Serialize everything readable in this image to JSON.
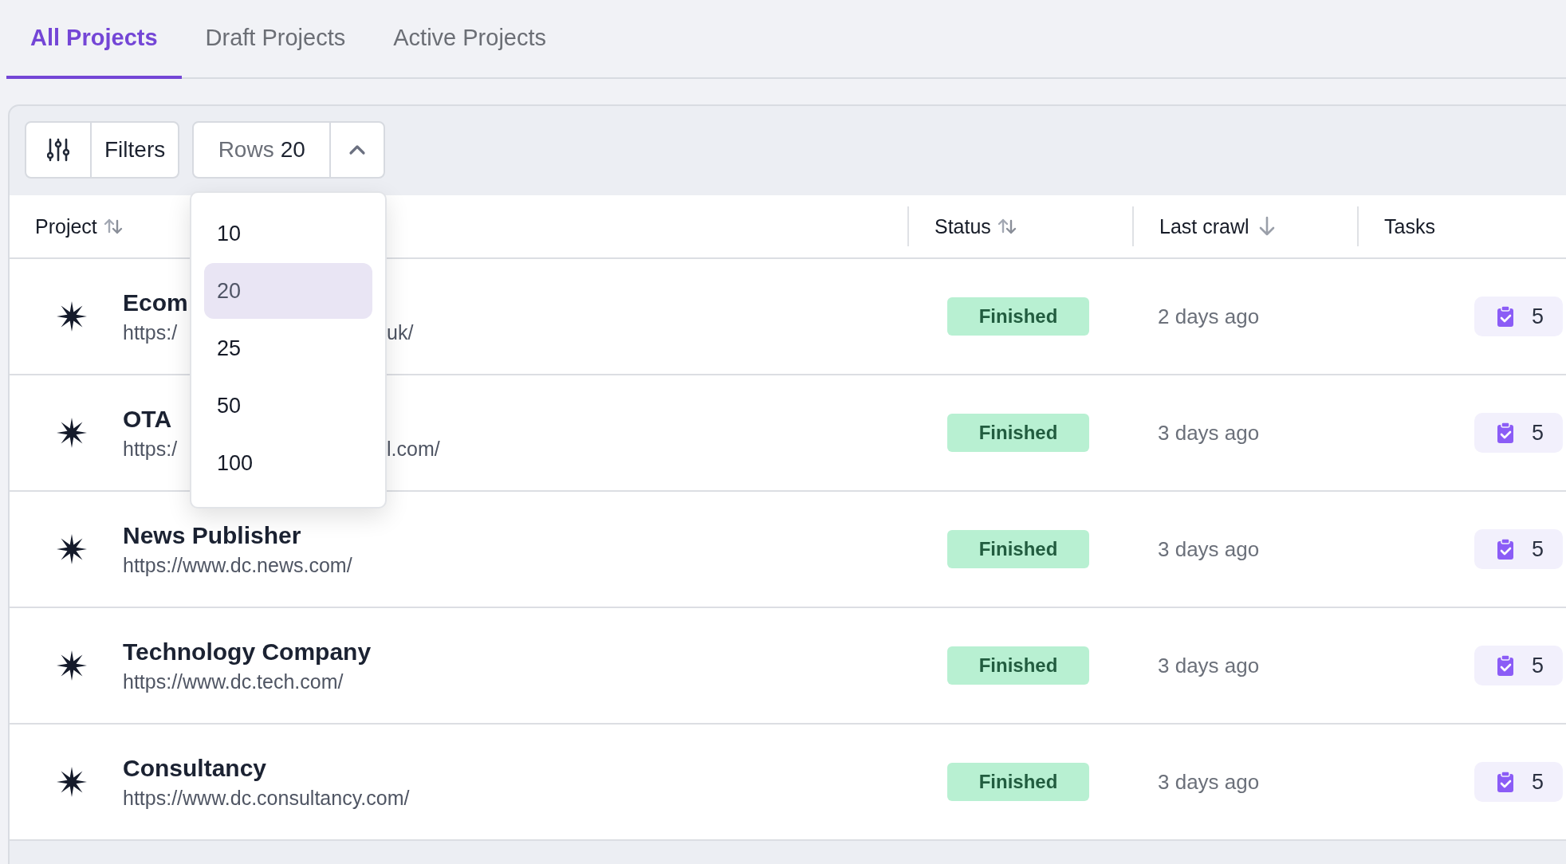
{
  "tabs": [
    {
      "label": "All Projects",
      "selected": true
    },
    {
      "label": "Draft Projects",
      "selected": false
    },
    {
      "label": "Active Projects",
      "selected": false
    }
  ],
  "toolbar": {
    "filters_label": "Filters",
    "rows_select": {
      "label": "Rows",
      "value": "20",
      "expanded": true
    }
  },
  "rows_options": [
    {
      "label": "10",
      "selected": false
    },
    {
      "label": "20",
      "selected": true
    },
    {
      "label": "25",
      "selected": false
    },
    {
      "label": "50",
      "selected": false
    },
    {
      "label": "100",
      "selected": false
    }
  ],
  "columns": [
    {
      "label": "Project",
      "kind": "sortable"
    },
    {
      "label": "Status",
      "kind": "sortable"
    },
    {
      "label": "Last crawl",
      "kind": "sorted"
    },
    {
      "label": "Tasks",
      "kind": "plain"
    }
  ],
  "rows": [
    {
      "name": "Ecom",
      "url": [
        "https:/",
        "uk/"
      ],
      "status": "Finished",
      "last_crawl": "2 days ago",
      "tasks": "5"
    },
    {
      "name": "OTA",
      "url": [
        "https:/",
        "l.com/"
      ],
      "status": "Finished",
      "last_crawl": "3 days ago",
      "tasks": "5"
    },
    {
      "name": "News Publisher",
      "url": [
        "https://www.dc.news.com/"
      ],
      "status": "Finished",
      "last_crawl": "3 days ago",
      "tasks": "5"
    },
    {
      "name": "Technology Company",
      "url": [
        "https://www.dc.tech.com/"
      ],
      "status": "Finished",
      "last_crawl": "3 days ago",
      "tasks": "5"
    },
    {
      "name": "Consultancy",
      "url": [
        "https://www.dc.consultancy.com/"
      ],
      "status": "Finished",
      "last_crawl": "3 days ago",
      "tasks": "5"
    }
  ]
}
